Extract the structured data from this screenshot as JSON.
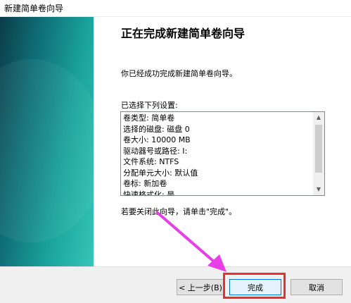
{
  "window": {
    "title": "新建简单卷向导"
  },
  "main": {
    "heading": "正在完成新建简单卷向导",
    "intro": "你已经成功完成新建简单卷向导。",
    "list_label": "已选择下列设置:",
    "settings": [
      "卷类型: 简单卷",
      "选择的磁盘: 磁盘 0",
      "卷大小: 10000 MB",
      "驱动器号或路径: I:",
      "文件系统: NTFS",
      "分配单元大小: 默认值",
      "卷标: 新加卷",
      "快速格式化: 是"
    ],
    "close_note": "若要关闭此向导，请单击\"完成\"。"
  },
  "buttons": {
    "back": "< 上一步(B)",
    "finish": "完成",
    "cancel": "取消"
  },
  "colors": {
    "annotation_arrow": "#e83ee8",
    "highlight_box": "#e8312f"
  },
  "icons": {
    "scroll_up": "▲",
    "scroll_down": "▼"
  }
}
